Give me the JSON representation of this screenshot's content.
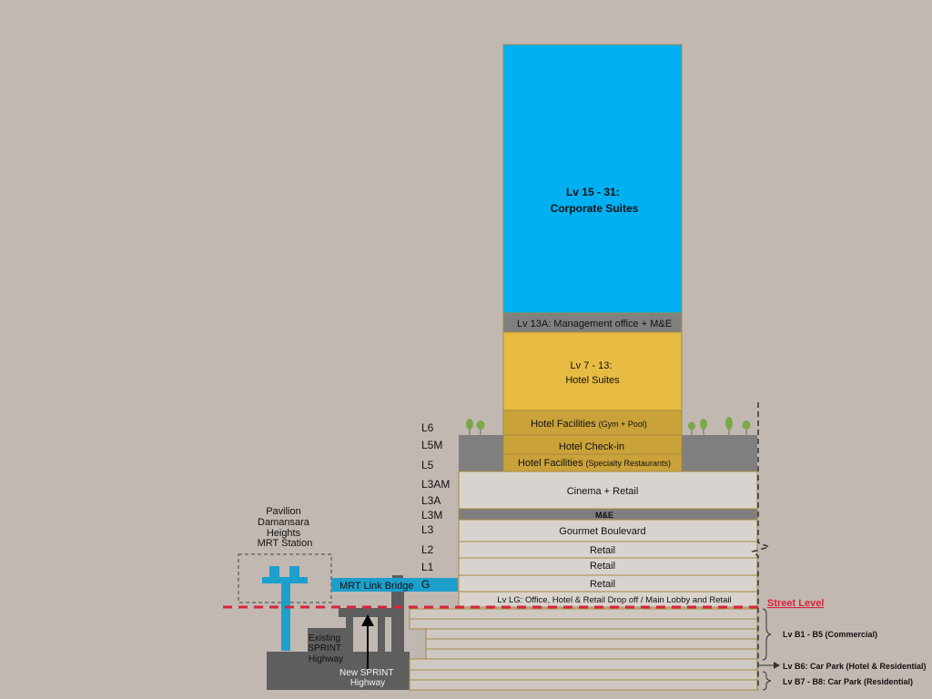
{
  "colors": {
    "background": "#c2b8b2",
    "corporate": "#00b0f0",
    "hotel_suites": "#e8bb42",
    "hotel_facilities": "#caa23a",
    "management": "#808080",
    "retail": "#d9d3cf",
    "podium_grey": "#7f7f7f",
    "basement": "#cfc8c2",
    "street_line": "#d8253a",
    "tree": "#7aa948"
  },
  "tower": {
    "corporate": {
      "line1": "Lv 15 - 31:",
      "line2": "Corporate Suites"
    },
    "management": "Lv 13A: Management office + M&E",
    "hotel_suites": {
      "line1": "Lv 7 - 13:",
      "line2": "Hotel Suites"
    },
    "hotel_facilities_gym": {
      "main": "Hotel Facilities ",
      "sub": "(Gym + Pool)"
    },
    "hotel_checkin": "Hotel Check-in",
    "hotel_facilities_rest": {
      "main": "Hotel Facilities ",
      "sub": "(Specialty Restaurants)"
    }
  },
  "podium": {
    "cinema": "Cinema + Retail",
    "me": "M&E",
    "gourmet": "Gourmet Boulevard",
    "retail_l2": "Retail",
    "retail_l1": "Retail",
    "retail_g": "Retail",
    "lg": "Lv LG: Office, Hotel & Retail Drop off / Main Lobby and Retail"
  },
  "level_labels": [
    "L6",
    "L5M",
    "L5",
    "L3AM",
    "L3A",
    "L3M",
    "L3",
    "L2",
    "L1",
    "G"
  ],
  "street_level": "Street Level",
  "basement_labels": {
    "b1_b5": "Lv B1 - B5 (Commercial)",
    "b6": "Lv B6: Car Park (Hotel & Residential)",
    "b7_b8": "Lv B7 - B8: Car Park (Residential)"
  },
  "mrt": {
    "station_lines": [
      "Pavilion",
      "Damansara",
      "Heights",
      "MRT Station"
    ],
    "link_bridge": "MRT Link Bridge"
  },
  "highway": {
    "existing": [
      "Existing",
      "SPRINT",
      "Highway"
    ],
    "new": [
      "New SPRINT",
      "Highway"
    ]
  }
}
